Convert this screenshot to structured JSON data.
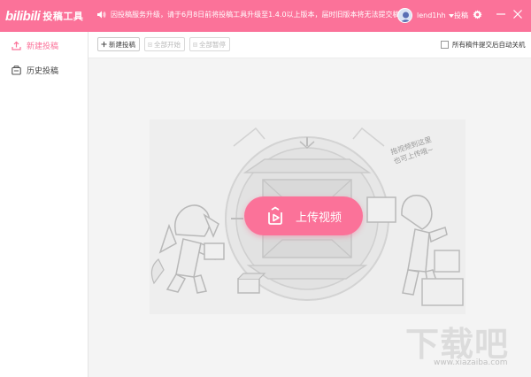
{
  "titlebar": {
    "logo_mark": "bilibili",
    "logo_text": "投稿工具",
    "notice": "因投稿服务升级，请于6月8日前将投稿工具升级至1.4.0以上版本，届时旧版本将无法提交稿件",
    "username": "lend1hh",
    "contribute_label": "投稿",
    "accent_color": "#fb7299"
  },
  "sidebar": {
    "items": [
      {
        "label": "新建投稿",
        "icon": "upload-icon",
        "active": true
      },
      {
        "label": "历史投稿",
        "icon": "history-icon",
        "active": false
      }
    ]
  },
  "toolbar": {
    "new_label": "新建投稿",
    "start_all_label": "全部开始",
    "pause_all_label": "全部暂停",
    "auto_shutdown_label": "所有稿件提交后自动关机",
    "auto_shutdown_checked": false
  },
  "main": {
    "upload_label": "上传视频",
    "drag_hint_line1": "拖视频到这里",
    "drag_hint_line2": "也可上传哦~"
  },
  "watermark": {
    "big": "下载吧",
    "small": "www.xiazaiba.com"
  }
}
